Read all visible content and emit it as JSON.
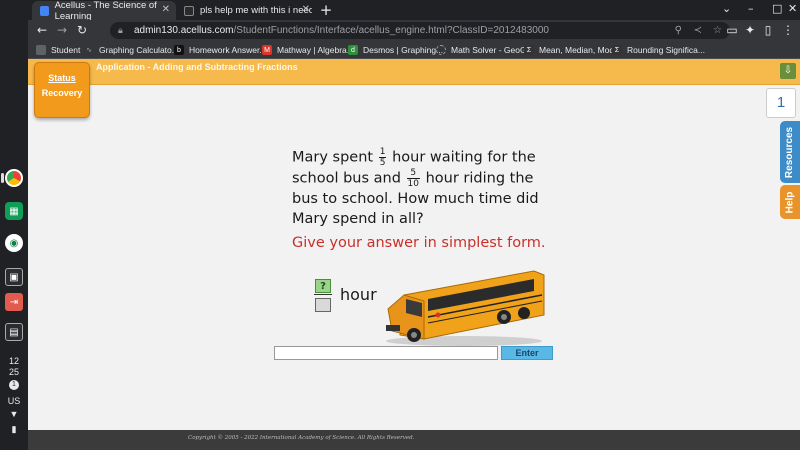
{
  "browser": {
    "tabs": [
      {
        "title": "Acellus - The Science of Learning",
        "active": true
      },
      {
        "title": "pls help me with this i need it as",
        "active": false
      }
    ],
    "url_host": "admin130.acellus.com",
    "url_path": "/StudentFunctions/Interface/acellus_engine.html?ClassID=2012483000",
    "bookmarks": [
      "Student",
      "Graphing Calculato...",
      "Homework Answer...",
      "Mathway | Algebra...",
      "Desmos | Graphing...",
      "Math Solver - GeoG...",
      "Mean, Median, Mod...",
      "Rounding Significa..."
    ]
  },
  "shelf": {
    "time_hour": "12",
    "time_minute": "25",
    "notification_count": "1",
    "locale": "US"
  },
  "page": {
    "header_title": "Application - Adding and Subtracting Fractions",
    "status_label": "Status",
    "status_value": "Recovery",
    "question_number": "1",
    "side_tabs": {
      "resources": "Resources",
      "help": "Help"
    },
    "question": {
      "part1": "Mary spent",
      "frac1_num": "1",
      "frac1_den": "5",
      "part2": "hour waiting for the school bus and",
      "frac2_num": "5",
      "frac2_den": "10",
      "part3": "hour riding the bus to school. How much time did Mary spend in all?"
    },
    "instruction": "Give your answer in simplest form.",
    "answer_placeholder_numerator": "?",
    "answer_unit": "hour",
    "input_value": "",
    "enter_label": "Enter",
    "footer": "Copyright © 2005 - 2022 International Academy of Science.  All Rights Reserved."
  },
  "colors": {
    "header_orange": "#f6b94c",
    "status_orange": "#f19a1c",
    "resources_blue": "#3d8cc8",
    "help_orange": "#e8942a",
    "instruction_red": "#c8302a",
    "enter_blue": "#5ab8e6"
  }
}
